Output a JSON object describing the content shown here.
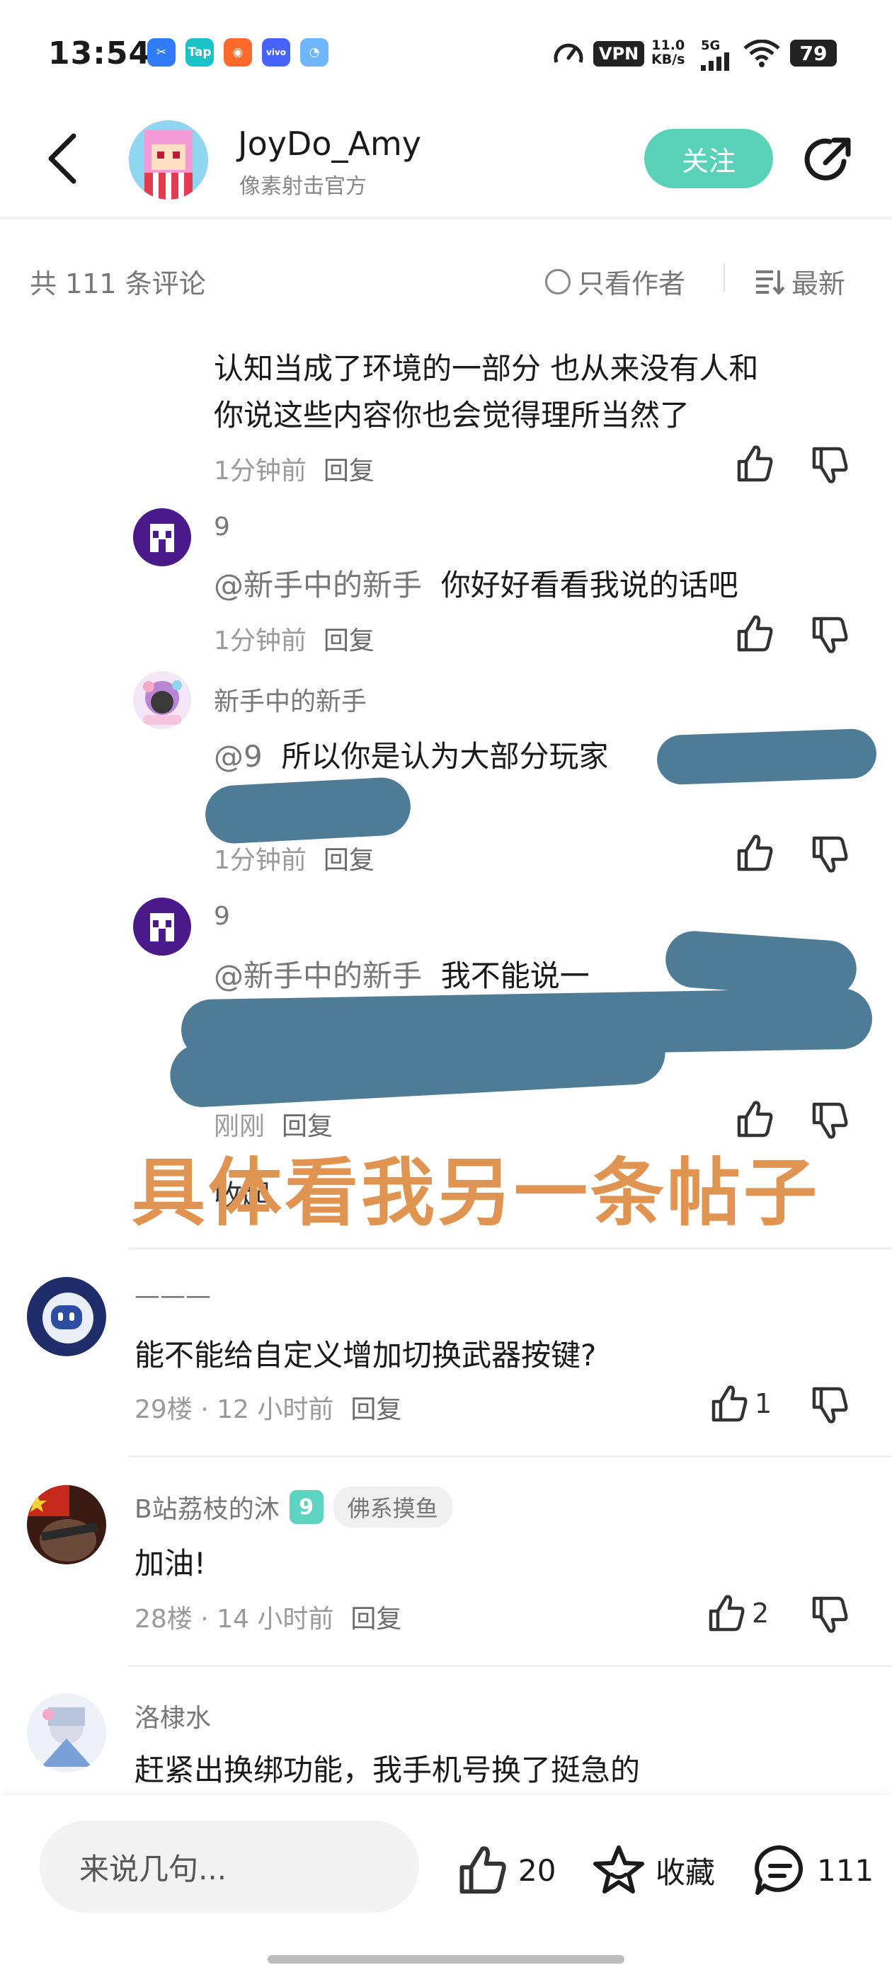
{
  "status_bar": {
    "time": "13:54",
    "app_icons": [
      {
        "name": "scissors-app-icon",
        "label": "✂",
        "color": "#2f7cf6"
      },
      {
        "name": "tap-app-icon",
        "label": "Tap",
        "color": "#19c3c8"
      },
      {
        "name": "grid-app-icon",
        "label": "◉",
        "color": "#ff6a2b"
      },
      {
        "name": "vivo-app-icon",
        "label": "vivo",
        "color": "#4662ff"
      },
      {
        "name": "circle-app-icon",
        "label": "◔",
        "color": "#6fb6ff"
      }
    ],
    "vpn": "VPN",
    "net_speed_value": "11.0",
    "net_speed_unit": "KB/s",
    "signal": "5G",
    "battery": "79"
  },
  "header": {
    "username": "JoyDo_Amy",
    "subtitle": "像素射击官方",
    "follow_label": "关注"
  },
  "filter": {
    "total": "共 111 条评论",
    "only_author": "只看作者",
    "sort": "最新"
  },
  "thread": {
    "top_reply": {
      "text_line1": "认知当成了环境的一部分 也从来没有人和",
      "text_line2": "你说这些内容你也会觉得理所当然了",
      "time": "1分钟前",
      "reply": "回复"
    },
    "replies": [
      {
        "user": "9",
        "mention": "@新手中的新手",
        "text": "你好好看看我说的话吧",
        "time": "1分钟前",
        "reply": "回复"
      },
      {
        "user": "新手中的新手",
        "mention": "@9",
        "text": "所以你是认为大部分玩家",
        "time": "1分钟前",
        "reply": "回复"
      },
      {
        "user": "9",
        "mention": "@新手中的新手",
        "text": "我不能说一",
        "time": "刚刚",
        "reply": "回复"
      }
    ],
    "collapse": "收起"
  },
  "overlay": "具体看我另一条帖子",
  "comments": [
    {
      "user": "———",
      "text": "能不能给自定义增加切换武器按键?",
      "floor": "29楼 · 12 小时前",
      "reply": "回复",
      "likes": "1"
    },
    {
      "user": "B站荔枝的沐",
      "level": "9",
      "tag": "佛系摸鱼",
      "text": "加油!",
      "floor": "28楼 · 14 小时前",
      "reply": "回复",
      "likes": "2"
    },
    {
      "user": "洛棣水",
      "text": "赶紧出换绑功能，我手机号换了挺急的"
    }
  ],
  "bottom_bar": {
    "placeholder": "来说几句...",
    "likes": "20",
    "favorite": "收藏",
    "comments": "111"
  }
}
